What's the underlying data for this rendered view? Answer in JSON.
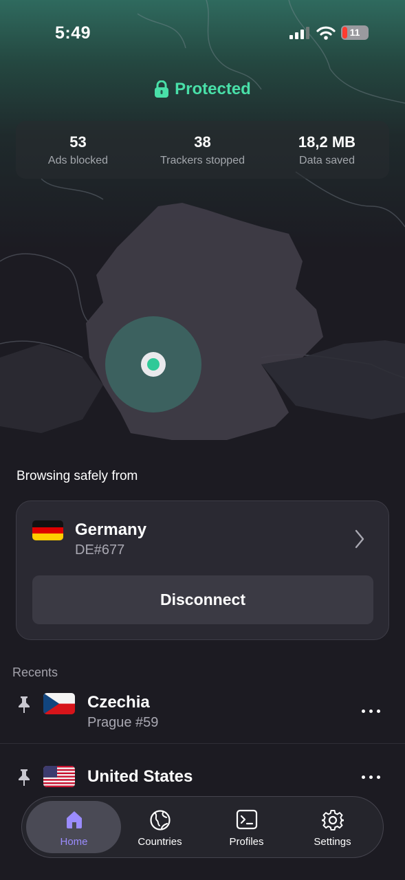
{
  "status_bar": {
    "time": "5:49",
    "battery": "11"
  },
  "protection": {
    "label": "Protected"
  },
  "stats": [
    {
      "value": "53",
      "label": "Ads blocked"
    },
    {
      "value": "38",
      "label": "Trackers stopped"
    },
    {
      "value": "18,2 MB",
      "label": "Data saved"
    }
  ],
  "browsing": {
    "label": "Browsing safely from"
  },
  "current_server": {
    "country": "Germany",
    "server": "DE#677",
    "disconnect_label": "Disconnect"
  },
  "recents": {
    "label": "Recents",
    "items": [
      {
        "country": "Czechia",
        "server": "Prague #59"
      },
      {
        "country": "United States",
        "server": ""
      }
    ]
  },
  "tabs": [
    {
      "label": "Home",
      "icon": "home-icon",
      "active": true
    },
    {
      "label": "Countries",
      "icon": "globe-icon"
    },
    {
      "label": "Profiles",
      "icon": "terminal-icon"
    },
    {
      "label": "Settings",
      "icon": "gear-icon"
    }
  ],
  "colors": {
    "accent_green": "#49e0a8",
    "active_tab": "#9b8cff",
    "background": "#1c1b22"
  }
}
